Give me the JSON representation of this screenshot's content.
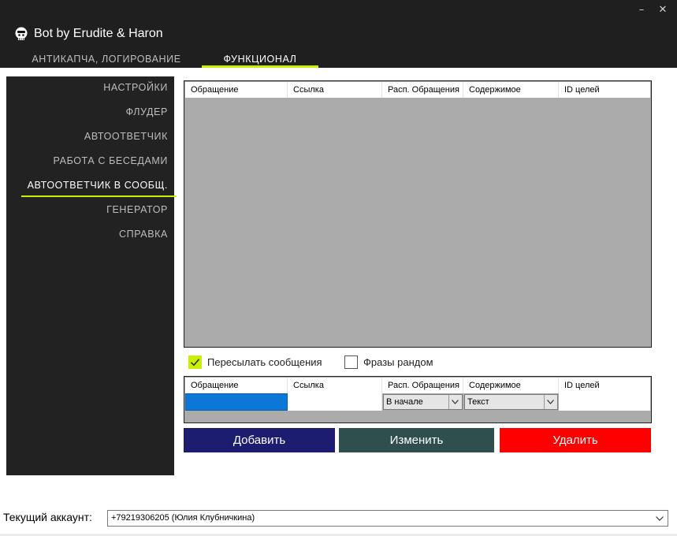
{
  "window": {
    "title": "Bot by Erudite & Haron",
    "minimize_label": "–",
    "close_label": "✕"
  },
  "top_tabs": [
    {
      "label": "АНТИКАПЧА, ЛОГИРОВАНИЕ"
    },
    {
      "label": "ФУНКЦИОНАЛ",
      "active": true
    }
  ],
  "sidebar": {
    "items": [
      {
        "label": "НАСТРОЙКИ"
      },
      {
        "label": "ФЛУДЕР"
      },
      {
        "label": "АВТООТВЕТЧИК"
      },
      {
        "label": "РАБОТА С БЕСЕДАМИ"
      },
      {
        "label": "АВТООТВЕТЧИК В СООБЩ.",
        "active": true
      },
      {
        "label": "ГЕНЕРАТОР"
      },
      {
        "label": "СПРАВКА"
      }
    ]
  },
  "main_grid": {
    "columns": [
      "Обращение",
      "Ссылка",
      "Расп. Обращения",
      "Содержимое",
      "ID целей"
    ],
    "rows": []
  },
  "options": {
    "forward_messages": {
      "label": "Пересылать сообщения",
      "checked": true
    },
    "random_phrases": {
      "label": "Фразы рандом",
      "checked": false
    }
  },
  "input_grid": {
    "columns": [
      "Обращение",
      "Ссылка",
      "Расп. Обращения",
      "Содержимое",
      "ID целей"
    ],
    "row": {
      "address": "",
      "link": "",
      "position": "В начале",
      "content": "Текст",
      "target_ids": ""
    }
  },
  "buttons": {
    "add": "Добавить",
    "edit": "Изменить",
    "delete": "Удалить"
  },
  "footer": {
    "account_label": "Текущий аккаунт:",
    "account_value": "+79219306205 (Юлия Клубничкина)"
  },
  "colors": {
    "header_bg": "#1f1f1f",
    "sidebar_bg": "#222222",
    "accent": "#c9f000",
    "grid_bg": "#ababab",
    "selected_cell": "#0b78d8",
    "add_button": "#1c1c70",
    "edit_button": "#2f4f4f",
    "delete_button": "#ff0000"
  }
}
